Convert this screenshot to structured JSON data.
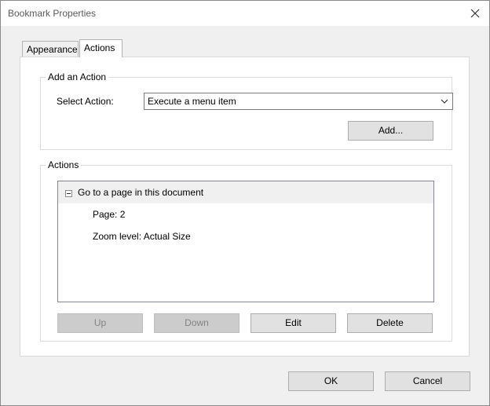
{
  "window": {
    "title": "Bookmark Properties"
  },
  "tabs": [
    {
      "label": "Appearance",
      "selected": false
    },
    {
      "label": "Actions",
      "selected": true
    }
  ],
  "add_action": {
    "group_label": "Add an Action",
    "select_label": "Select Action:",
    "selected_action": "Execute a menu item",
    "add_button": "Add..."
  },
  "actions": {
    "group_label": "Actions",
    "list": {
      "item_label": "Go to a page in this document",
      "details": [
        "Page: 2",
        "Zoom level: Actual Size"
      ]
    },
    "buttons": {
      "up": "Up",
      "down": "Down",
      "edit": "Edit",
      "delete": "Delete"
    }
  },
  "footer": {
    "ok": "OK",
    "cancel": "Cancel"
  },
  "colors": {
    "dialog_bg": "#f0f0f0",
    "panel_bg": "#ffffff",
    "button_bg": "#e1e1e1",
    "disabled_text": "#838383"
  }
}
